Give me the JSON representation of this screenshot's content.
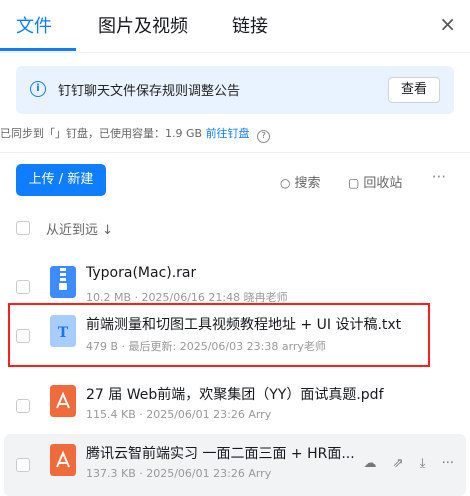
{
  "tabs": [
    {
      "label": "文件",
      "active": true
    },
    {
      "label": "图片及视频",
      "active": false
    },
    {
      "label": "链接",
      "active": false
    }
  ],
  "close_icon": "×",
  "notice": {
    "text": "钉钉聊天文件保存规则调整公告",
    "button_label": "查看",
    "icon": "info-icon"
  },
  "sync": {
    "prefix": "已同步到「」钉盘，已使用容量：1.9 GB",
    "link": "前往钉盘",
    "help_icon": "help-icon"
  },
  "toolbar": {
    "upload_label": "上传 / 新建",
    "search_label": "搜索",
    "recycle_label": "回收站",
    "more_label": "···"
  },
  "sort": {
    "label": "从近到远 ↓"
  },
  "files": [
    {
      "name": "Typora(Mac).rar",
      "meta": "10.2 MB · 2025/06/16 21:48 晓冉老师",
      "icon": "zip-icon",
      "icon_color": "#3d8bfd"
    },
    {
      "name": "前端测量和切图工具视频教程地址 + UI 设计稿.txt",
      "meta": "479 B · 最后更新: 2025/06/03 23:38 arry老师",
      "icon": "txt-icon",
      "icon_color": "#a8cdfd"
    },
    {
      "name": "27 届 Web前端，欢聚集团（YY）面试真题.pdf",
      "meta": "115.4 KB · 2025/06/01 23:26 Arry",
      "icon": "pdf-icon",
      "icon_color": "#f06b3c"
    },
    {
      "name": "腾讯云智前端实习 一面二面三面 + HR面....",
      "meta": "137.3 KB · 2025/06/01 23:26 Arry",
      "icon": "pdf-icon",
      "icon_color": "#f06b3c"
    }
  ],
  "row_actions": [
    "share-icon",
    "open-icon",
    "download-icon",
    "more-icon"
  ],
  "colors": {
    "accent": "#0f7dff",
    "highlight": "#ff1e1e"
  }
}
